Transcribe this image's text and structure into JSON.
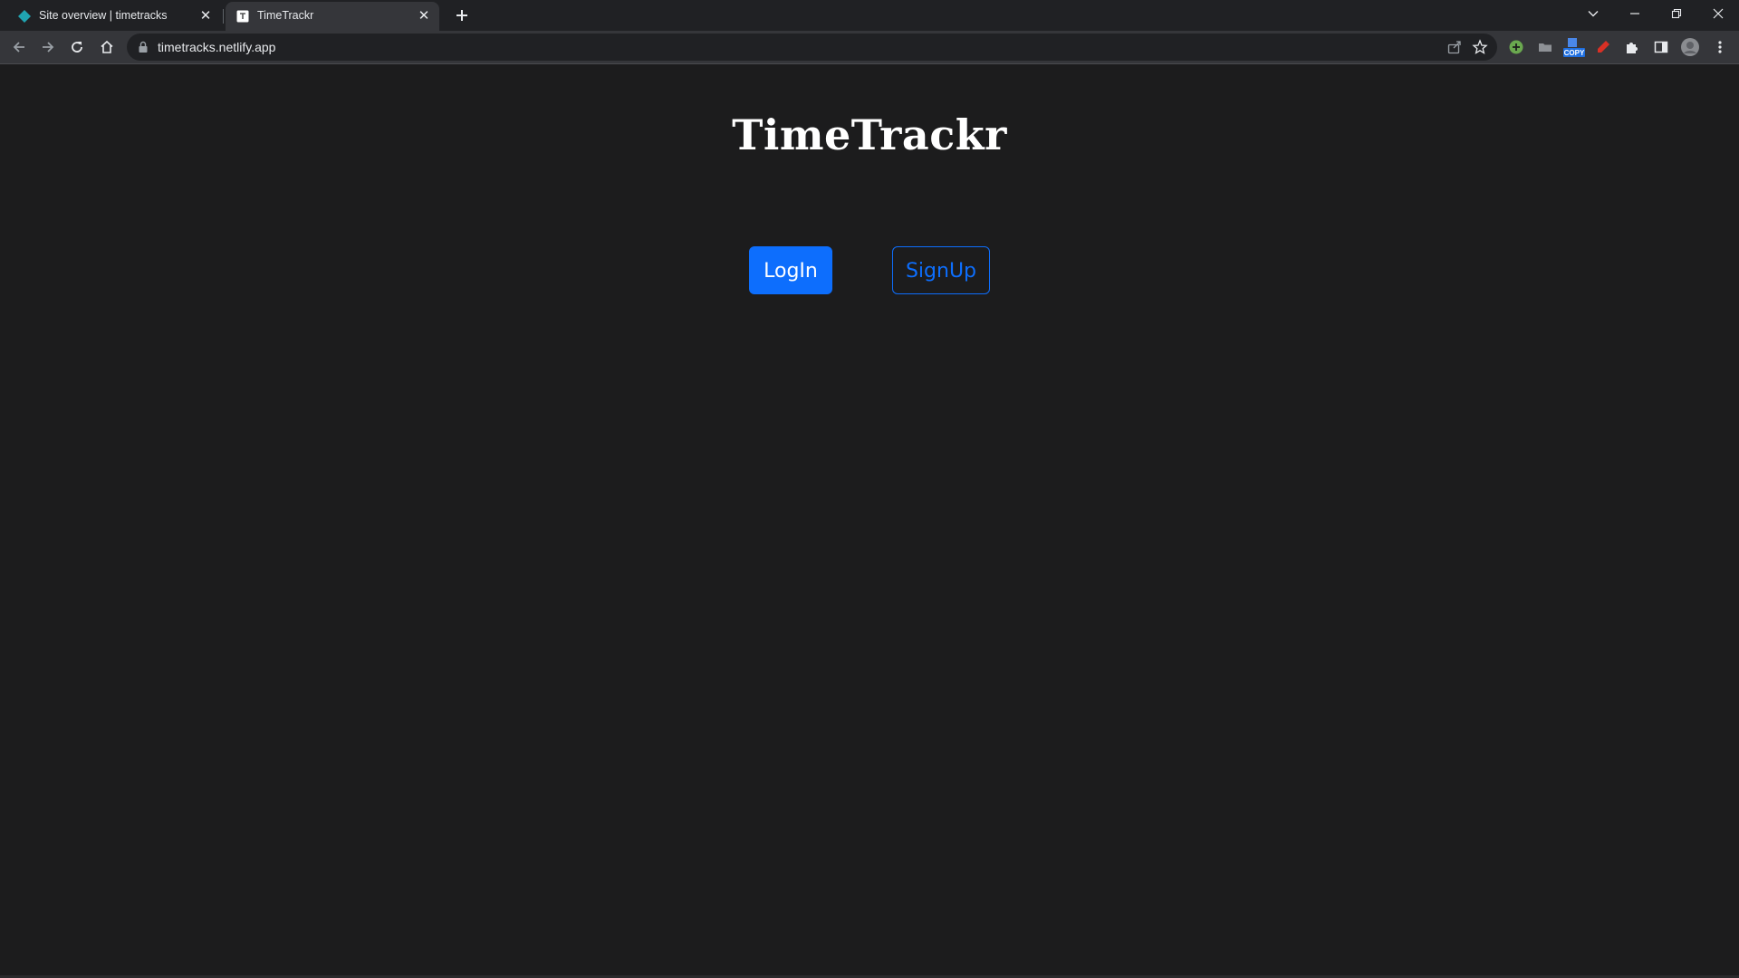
{
  "browser": {
    "tabs": [
      {
        "title": "Site overview | timetracks",
        "favicon": "netlify-diamond-icon",
        "active": false
      },
      {
        "title": "TimeTrackr",
        "favicon": "page-icon",
        "active": true
      }
    ],
    "address": "timetracks.netlify.app",
    "extension_badge": "COPY"
  },
  "page": {
    "title": "TimeTrackr",
    "buttons": {
      "login_label": "LogIn",
      "signup_label": "SignUp"
    }
  },
  "colors": {
    "page_background": "#1c1c1d",
    "primary": "#0d6efd",
    "title_text": "#ffffff",
    "browser_frame": "#202124",
    "toolbar": "#35363a"
  }
}
